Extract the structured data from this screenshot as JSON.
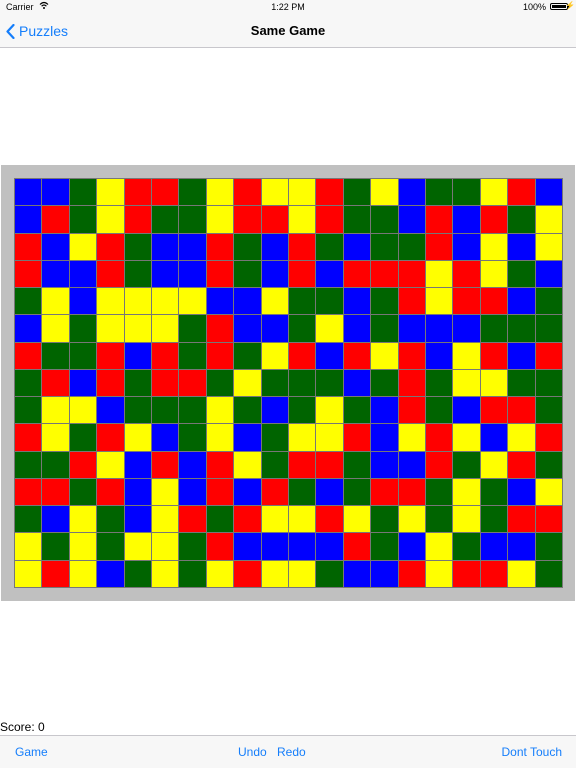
{
  "status_bar": {
    "carrier": "Carrier",
    "time": "1:22 PM",
    "battery": "100%"
  },
  "nav": {
    "back_label": "Puzzles",
    "title": "Same Game"
  },
  "colors": {
    "B": "#0000ff",
    "G": "#006400",
    "Y": "#ffff00",
    "R": "#ff0000",
    "frame": "#c0c0c0",
    "accent": "#157efb"
  },
  "board": {
    "cols": 20,
    "rows": 15,
    "cells": [
      "BBGYRRGYRYYRGYBGGYRB",
      "BRGYRGGYRRYRGGBRBRGY",
      "RBYRGBBRGBRGBGGRBYBY",
      "RBBRGBBRGBRBRRRYRYGB",
      "GYBYYYYBBYGGBGRYRRBG",
      "BYGYYYGRBBGYBGBBBGGG",
      "RGGRBRGRGYRBRYRBYRBR",
      "GRBRGRRGYGGGBGRGYYGG",
      "GYYBGGGYGBGYGBRGBRRG",
      "RYGRYBGYBGYYRBYRYBYR",
      "GGRYBRBRYGRRGBBRGYRG",
      "RRGRBYBRBRGBGRRGYGBY",
      "GBYGBYRGRYYRYGYGYGRR",
      "YGYGYYGRBBBBRGBYGBBG",
      "YRYBGYGYRYYGBBRYRRYG"
    ]
  },
  "score": {
    "label": "Score: 0"
  },
  "toolbar": {
    "game": "Game",
    "undo": "Undo",
    "redo": "Redo",
    "dont_touch": "Dont Touch"
  }
}
